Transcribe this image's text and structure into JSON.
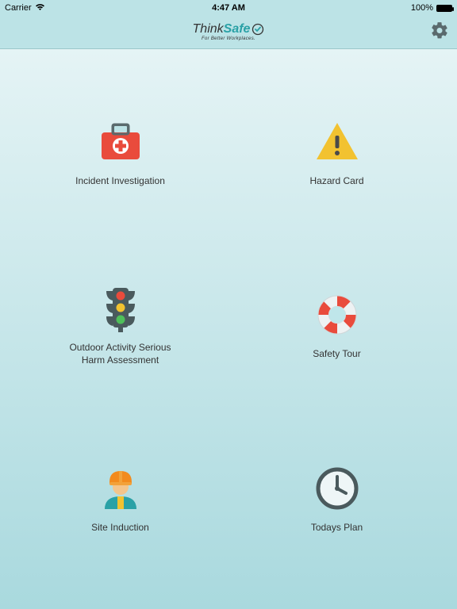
{
  "status": {
    "carrier": "Carrier",
    "wifi": "wifi",
    "time": "4:47 AM",
    "battery_pct": "100%"
  },
  "header": {
    "brand_thin": "Think",
    "brand_bold": "Safe",
    "tagline": "For Better Workplaces.",
    "settings_aria": "Settings"
  },
  "tiles": [
    {
      "label": "Incident Investigation"
    },
    {
      "label": "Hazard Card"
    },
    {
      "label": "Outdoor Activity Serious Harm Assessment"
    },
    {
      "label": "Safety Tour"
    },
    {
      "label": "Site Induction"
    },
    {
      "label": "Todays Plan"
    }
  ]
}
